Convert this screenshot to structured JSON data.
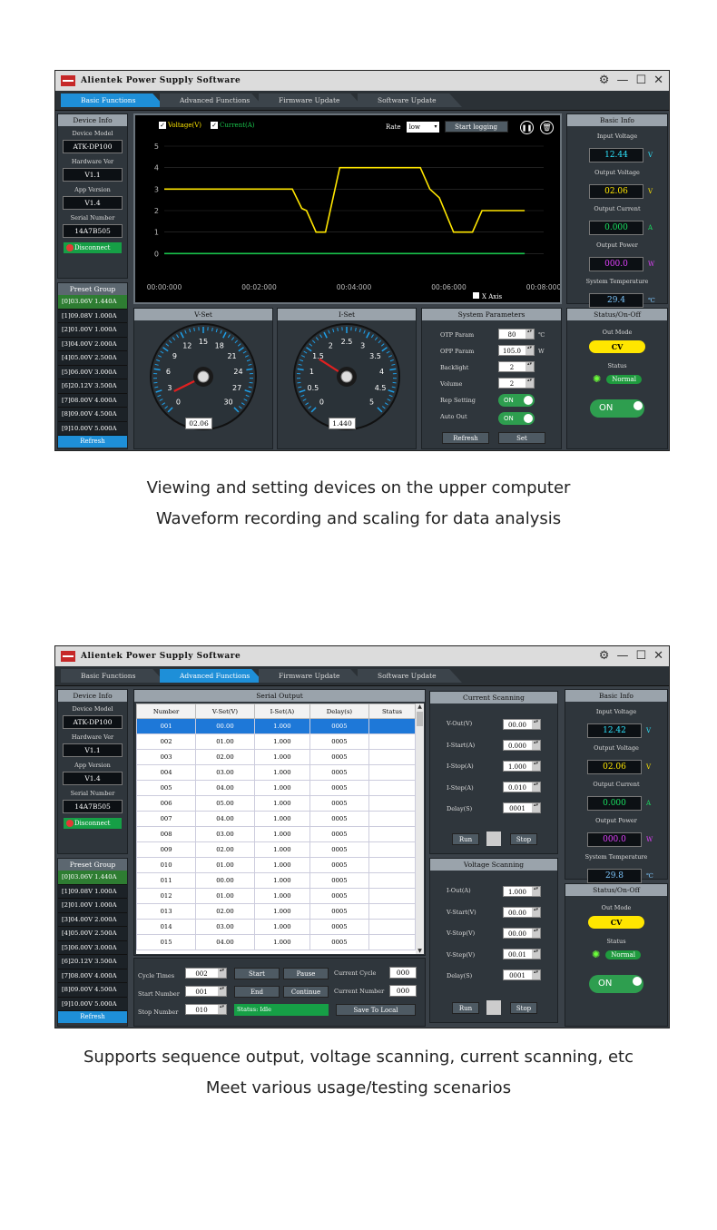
{
  "app_title": "Alientek Power Supply Software",
  "tabs": [
    "Basic Functions",
    "Advanced Functions",
    "Firmware Update",
    "Software Update"
  ],
  "device_info": {
    "header": "Device Info",
    "model_label": "Device Model",
    "model": "ATK-DP100",
    "hw_label": "Hardware Ver",
    "hw": "V1.1",
    "app_label": "App Version",
    "app": "V1.4",
    "sn_label": "Serial Number",
    "sn": "14A7B505",
    "disconnect": "Disconnect"
  },
  "preset": {
    "header": "Preset Group",
    "items": [
      "[0]03.06V 1.440A",
      "[1]09.08V 1.000A",
      "[2]01.00V 1.000A",
      "[3]04.00V 2.000A",
      "[4]05.00V 2.500A",
      "[5]06.00V 3.000A",
      "[6]20.12V 3.500A",
      "[7]08.00V 4.000A",
      "[8]09.00V 4.500A",
      "[9]10.00V 5.000A"
    ],
    "refresh": "Refresh"
  },
  "chart": {
    "voltage_label": "Voltage(V)",
    "current_label": "Current(A)",
    "rate_label": "Rate",
    "rate_value": "low",
    "start_logging": "Start logging",
    "xaxis_label": "X Axis",
    "yticks": [
      "5",
      "4",
      "3",
      "2",
      "1",
      "0"
    ],
    "xticks": [
      "00:00:000",
      "00:02:000",
      "00:04:000",
      "00:06:000",
      "00:08:000"
    ]
  },
  "chart_data": {
    "type": "line",
    "xlabel": "",
    "ylabel": "",
    "ylim": [
      -1,
      5
    ],
    "xlim": [
      0,
      8
    ],
    "series": [
      {
        "name": "Voltage(V)",
        "color": "#ffe600",
        "x": [
          0,
          2.7,
          2.9,
          3.0,
          3.2,
          3.4,
          3.7,
          5.4,
          5.6,
          5.8,
          6.1,
          6.5,
          6.7,
          7.6
        ],
        "y": [
          3.0,
          3.0,
          2.1,
          2.0,
          1.0,
          1.0,
          4.0,
          4.0,
          3.0,
          2.6,
          1.0,
          1.0,
          2.0,
          2.0
        ]
      },
      {
        "name": "Current(A)",
        "color": "#19c24b",
        "x": [
          0,
          7.6
        ],
        "y": [
          0,
          0
        ]
      }
    ]
  },
  "vset": {
    "header": "V-Set",
    "ticks": [
      "0",
      "3",
      "6",
      "9",
      "12",
      "15",
      "18",
      "21",
      "24",
      "27",
      "30"
    ],
    "value": "02.06",
    "fraction": 0.069
  },
  "iset": {
    "header": "I-Set",
    "ticks": [
      "0",
      "0.5",
      "1",
      "1.5",
      "2",
      "2.5",
      "3",
      "3.5",
      "4",
      "4.5",
      "5"
    ],
    "value": "1.440",
    "fraction": 0.288
  },
  "sys_params": {
    "header": "System Parameters",
    "otp_label": "OTP Param",
    "otp": "80",
    "otp_unit": "℃",
    "opp_label": "OPP Param",
    "opp": "105.0",
    "opp_unit": "W",
    "backlight_label": "Backlight",
    "backlight": "2",
    "volume_label": "Volume",
    "volume": "2",
    "rep_label": "Rep Setting",
    "rep": "ON",
    "auto_label": "Auto Out",
    "auto": "ON",
    "refresh": "Refresh",
    "set": "Set"
  },
  "basic_info1": {
    "header": "Basic Info",
    "in_label": "Input Voltage",
    "in": "12.44",
    "in_unit": "V",
    "out_v_label": "Output Voltage",
    "out_v": "02.06",
    "out_v_unit": "V",
    "out_i_label": "Output Current",
    "out_i": "0.000",
    "out_i_unit": "A",
    "pow_label": "Output Power",
    "pow": "000.0",
    "pow_unit": "W",
    "temp_label": "System Temperature",
    "temp": "29.4",
    "temp_unit": "℃"
  },
  "status1": {
    "header": "Status/On-Off",
    "mode_label": "Out Mode",
    "mode": "CV",
    "status_label": "Status",
    "status": "Normal",
    "onoff": "ON"
  },
  "serial": {
    "header": "Serial Output",
    "columns": [
      "Number",
      "V-Set(V)",
      "I-Set(A)",
      "Delay(s)",
      "Status"
    ],
    "rows": [
      [
        "001",
        "00.00",
        "1.000",
        "0005",
        ""
      ],
      [
        "002",
        "01.00",
        "1.000",
        "0005",
        ""
      ],
      [
        "003",
        "02.00",
        "1.000",
        "0005",
        ""
      ],
      [
        "004",
        "03.00",
        "1.000",
        "0005",
        ""
      ],
      [
        "005",
        "04.00",
        "1.000",
        "0005",
        ""
      ],
      [
        "006",
        "05.00",
        "1.000",
        "0005",
        ""
      ],
      [
        "007",
        "04.00",
        "1.000",
        "0005",
        ""
      ],
      [
        "008",
        "03.00",
        "1.000",
        "0005",
        ""
      ],
      [
        "009",
        "02.00",
        "1.000",
        "0005",
        ""
      ],
      [
        "010",
        "01.00",
        "1.000",
        "0005",
        ""
      ],
      [
        "011",
        "00.00",
        "1.000",
        "0005",
        ""
      ],
      [
        "012",
        "01.00",
        "1.000",
        "0005",
        ""
      ],
      [
        "013",
        "02.00",
        "1.000",
        "0005",
        ""
      ],
      [
        "014",
        "03.00",
        "1.000",
        "0005",
        ""
      ],
      [
        "015",
        "04.00",
        "1.000",
        "0005",
        ""
      ]
    ],
    "cycle_label": "Cycle Times",
    "cycle": "002",
    "start_label": "Start Number",
    "start": "001",
    "stop_label": "Stop Number",
    "stop": "010",
    "btn_start": "Start",
    "btn_pause": "Pause",
    "btn_end": "End",
    "btn_continue": "Continue",
    "status": "Status: Idle",
    "save": "Save To Local",
    "cur_cycle_label": "Current Cycle",
    "cur_cycle": "000",
    "cur_num_label": "Current Number",
    "cur_num": "000"
  },
  "cur_scan": {
    "header": "Current Scanning",
    "vout_label": "V-Out(V)",
    "vout": "00.00",
    "istart_label": "I-Start(A)",
    "istart": "0.000",
    "istop_label": "I-Stop(A)",
    "istop": "1.000",
    "istep_label": "I-Step(A)",
    "istep": "0.010",
    "delay_label": "Delay(S)",
    "delay": "0001",
    "run": "Run",
    "stop": "Stop"
  },
  "volt_scan": {
    "header": "Voltage Scanning",
    "iout_label": "I-Out(A)",
    "iout": "1.000",
    "vstart_label": "V-Start(V)",
    "vstart": "00.00",
    "vstop_label": "V-Stop(V)",
    "vstop": "00.00",
    "vstep_label": "V-Step(V)",
    "vstep": "00.01",
    "delay_label": "Delay(S)",
    "delay": "0001",
    "run": "Run",
    "stop": "Stop"
  },
  "basic_info2": {
    "header": "Basic Info",
    "in_label": "Input Voltage",
    "in": "12.42",
    "in_unit": "V",
    "out_v_label": "Output Voltage",
    "out_v": "02.06",
    "out_v_unit": "V",
    "out_i_label": "Output Current",
    "out_i": "0.000",
    "out_i_unit": "A",
    "pow_label": "Output Power",
    "pow": "000.0",
    "pow_unit": "W",
    "temp_label": "System Temperature",
    "temp": "29.8",
    "temp_unit": "℃"
  },
  "status2": {
    "header": "Status/On-Off",
    "mode_label": "Out Mode",
    "mode": "CV",
    "status_label": "Status",
    "status": "Normal",
    "onoff": "ON"
  },
  "captions": {
    "c1": "Viewing and setting devices on the upper computer",
    "c2": "Waveform recording and scaling for data analysis",
    "c3": "Supports sequence output, voltage scanning, current scanning, etc",
    "c4": "Meet various usage/testing scenarios"
  },
  "colors": {
    "accent": "#1e8fd8",
    "voltage": "#ffe600",
    "current": "#19c24b",
    "ok": "#2e9e4f"
  }
}
